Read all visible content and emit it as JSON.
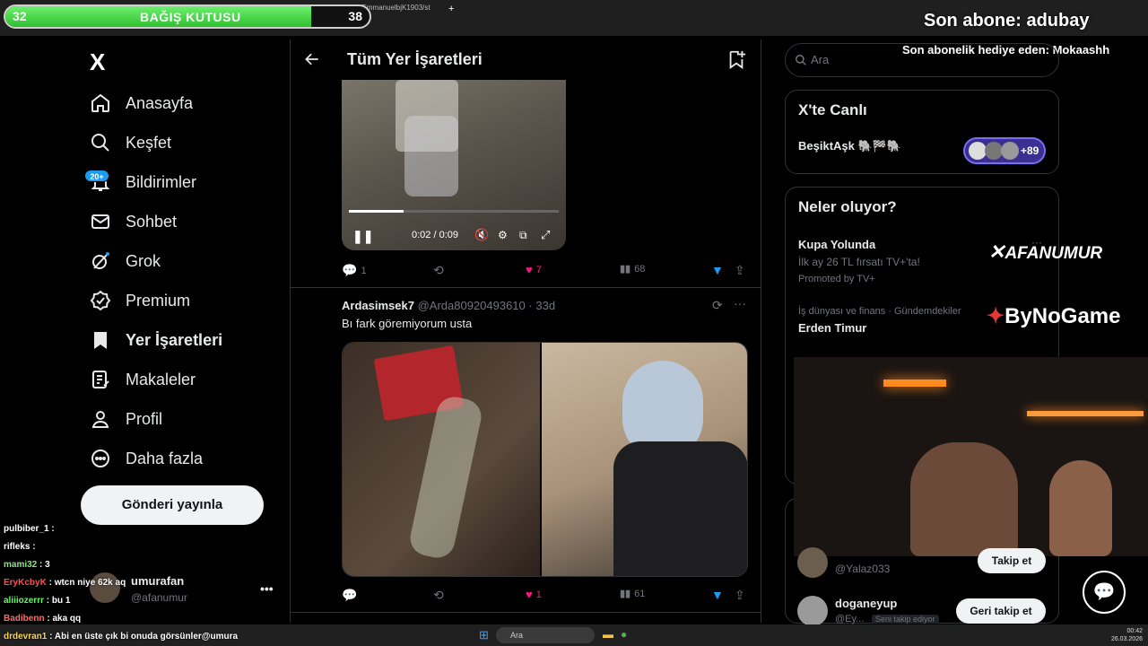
{
  "browser": {
    "tabs": [
      "",
      "",
      "x.com/EmmanuelbjK1903/statu"
    ],
    "address": ""
  },
  "donation": {
    "title": "BAĞIŞ KUTUSU",
    "current": "32",
    "goal": "38",
    "progress": 0.84
  },
  "overlay": {
    "last_sub": "Son abone: adubay",
    "last_gift": "Son abonelik hediye eden: Mokaashh"
  },
  "nav": {
    "logo": "X",
    "items": [
      {
        "label": "Anasayfa",
        "icon": "home-icon"
      },
      {
        "label": "Keşfet",
        "icon": "search-icon"
      },
      {
        "label": "Bildirimler",
        "icon": "bell-icon"
      },
      {
        "label": "Sohbet",
        "icon": "mail-icon"
      },
      {
        "label": "Grok",
        "icon": "grok-icon"
      },
      {
        "label": "Premium",
        "icon": "verified-icon"
      },
      {
        "label": "Yer İşaretleri",
        "icon": "bookmark-icon"
      },
      {
        "label": "Makaleler",
        "icon": "article-icon"
      },
      {
        "label": "Profil",
        "icon": "person-icon"
      },
      {
        "label": "Daha fazla",
        "icon": "more-circle-icon"
      }
    ],
    "notif_badge": "20+",
    "post_button": "Gönderi yayınla"
  },
  "account": {
    "name": "umurafan",
    "handle": "@afanumur"
  },
  "main": {
    "title": "Tüm Yer İşaretleri",
    "tweet1": {
      "video_time": "0:02 / 0:09",
      "video_progress": 0.22,
      "replies": "1",
      "likes": "7",
      "views": "68"
    },
    "tweet2": {
      "name": "Ardasimsek7",
      "handle": "@Arda80920493610",
      "age": "33d",
      "text": "Bı fark göremiyorum usta",
      "likes": "1",
      "views": "61"
    }
  },
  "right": {
    "search_placeholder": "Ara",
    "live": {
      "title": "X'te Canlı",
      "name": "BeşiktAşk 🐘🏁🐘",
      "count": "+89"
    },
    "trends": {
      "title": "Neler oluyor?",
      "promo_title": "Kupa Yolunda",
      "promo_text": "İlk ay 26 TL fırsatı TV+'ta!",
      "promo_by": "Promoted by TV+",
      "category": "İş dünyası ve finans · Gündemdekiler",
      "trend_name": "Erden Timur"
    },
    "follow": [
      {
        "name": "Yalaz033",
        "handle": "@Yalaz033",
        "button": "Takip et",
        "note": ""
      },
      {
        "name": "doganeyup",
        "handle": "@Ey...",
        "button": "Geri takip et",
        "note": "Seni takip ediyor"
      }
    ]
  },
  "sponsors": {
    "afanumur": "AFANUMUR",
    "bynogame": "ByNoGame"
  },
  "chat": [
    {
      "user": "pulbiber_1",
      "msg": "",
      "color": "#fff"
    },
    {
      "user": "rifleks",
      "msg": "",
      "color": "#fff"
    },
    {
      "user": "mami32",
      "msg": "3",
      "color": "#8fe388"
    },
    {
      "user": "EryKcbyK",
      "msg": "wtcn niye 62k aq",
      "color": "#ff4d4d"
    },
    {
      "user": "aliiiozerrr",
      "msg": "bu 1",
      "color": "#5dff5d"
    },
    {
      "user": "Badibenn",
      "msg": "aka qq",
      "color": "#ff6b6b"
    },
    {
      "user": "drdevran1",
      "msg": "Abi en üste çık bi onuda görsünler@umura",
      "color": "#ffd54a"
    }
  ],
  "taskbar": {
    "search": "Ara",
    "time": "00:42",
    "date": "26.03.2026"
  }
}
